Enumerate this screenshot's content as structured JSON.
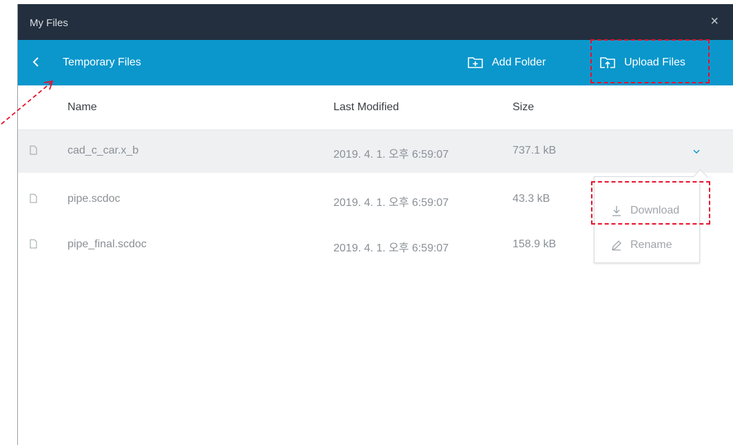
{
  "window": {
    "title": "My Files",
    "close_glyph": "×"
  },
  "nav": {
    "back_icon": "chevron-left-icon",
    "breadcrumb": "Temporary Files",
    "add_folder_label": "Add Folder",
    "upload_files_label": "Upload Files"
  },
  "columns": {
    "name": "Name",
    "last_modified": "Last Modified",
    "size": "Size"
  },
  "files": [
    {
      "name": "cad_c_car.x_b",
      "modified": "2019. 4. 1. 오후 6:59:07",
      "size": "737.1 kB",
      "selected": true
    },
    {
      "name": "pipe.scdoc",
      "modified": "2019. 4. 1. 오후 6:59:07",
      "size": "43.3 kB",
      "selected": false
    },
    {
      "name": "pipe_final.scdoc",
      "modified": "2019. 4. 1. 오후 6:59:07",
      "size": "158.9 kB",
      "selected": false
    }
  ],
  "context_menu": {
    "download_label": "Download",
    "rename_label": "Rename"
  },
  "colors": {
    "titlebar": "#232f3e",
    "navbar": "#0b97cc",
    "highlight": "#e8102b"
  }
}
